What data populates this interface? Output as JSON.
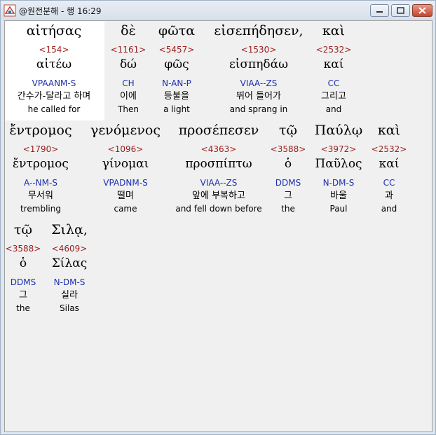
{
  "window": {
    "title": "@원전분해 - 행 16:29"
  },
  "rows": [
    {
      "words": [
        {
          "greek": "αἰτήσας",
          "strong": "<154>",
          "lemma": "αἰτέω",
          "morph": "VPAANM-S",
          "korean": "간수가-달라고 하며",
          "english": "he called for"
        },
        {
          "greek": "δὲ",
          "strong": "<1161>",
          "lemma": "δώ",
          "morph": "CH",
          "korean": "이에",
          "english": "Then"
        },
        {
          "greek": "φῶτα",
          "strong": "<5457>",
          "lemma": "φῶς",
          "morph": "N-AN-P",
          "korean": "등불을",
          "english": "a light"
        },
        {
          "greek": "εἰσεπήδησεν,",
          "strong": "<1530>",
          "lemma": "εἰσπηδάω",
          "morph": "VIAA--ZS",
          "korean": "뛰어 들어가",
          "english": "and sprang in"
        },
        {
          "greek": "καὶ",
          "strong": "<2532>",
          "lemma": "καί",
          "morph": "CC",
          "korean": "그리고",
          "english": "and"
        }
      ]
    },
    {
      "words": [
        {
          "greek": "ἔντρομος",
          "strong": "<1790>",
          "lemma": "ἔντρομος",
          "morph": "A--NM-S",
          "korean": "무서워",
          "english": "trembling"
        },
        {
          "greek": "γενόμενος",
          "strong": "<1096>",
          "lemma": "γίνομαι",
          "morph": "VPADNM-S",
          "korean": "떨며",
          "english": "came"
        },
        {
          "greek": "προσέπεσεν",
          "strong": "<4363>",
          "lemma": "προσπίπτω",
          "morph": "VIAA--ZS",
          "korean": "앞에 부복하고",
          "english": "and fell down before"
        },
        {
          "greek": "τῷ",
          "strong": "<3588>",
          "lemma": "ὁ",
          "morph": "DDMS",
          "korean": "그",
          "english": "the"
        },
        {
          "greek": "Παύλῳ",
          "strong": "<3972>",
          "lemma": "Παῦλος",
          "morph": "N-DM-S",
          "korean": "바울",
          "english": "Paul"
        },
        {
          "greek": "καὶ",
          "strong": "<2532>",
          "lemma": "καί",
          "morph": "CC",
          "korean": "과",
          "english": "and"
        }
      ]
    },
    {
      "words": [
        {
          "greek": "τῷ",
          "strong": "<3588>",
          "lemma": "ὁ",
          "morph": "DDMS",
          "korean": "그",
          "english": "the"
        },
        {
          "greek": "Σιλᾳ,",
          "strong": "<4609>",
          "lemma": "Σίλας",
          "morph": "N-DM-S",
          "korean": "실라",
          "english": "Silas"
        }
      ]
    }
  ]
}
